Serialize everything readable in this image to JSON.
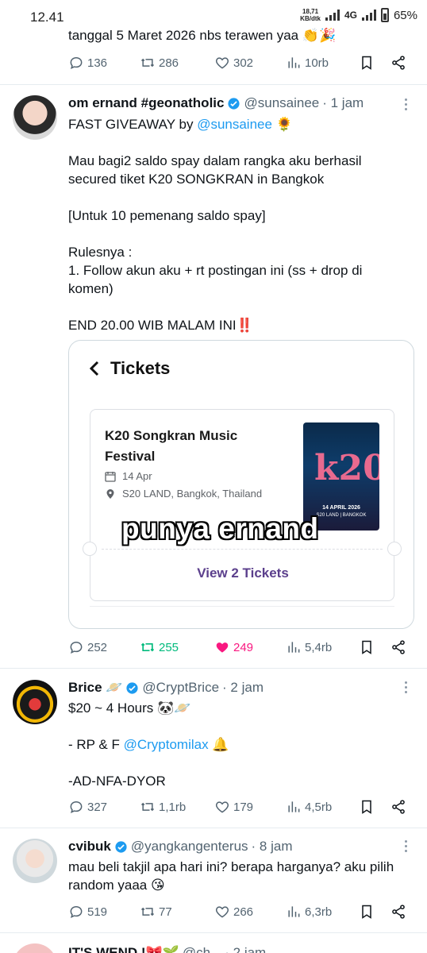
{
  "status": {
    "time": "12.41",
    "net_speed_value": "18,71",
    "net_speed_unit": "KB/dtk",
    "network": "4G",
    "battery": "65%"
  },
  "prev_tweet": {
    "text_tail": "tanggal 5 Maret 2026 nbs terawen yaa 👏🎉",
    "replies": "136",
    "retweets": "286",
    "likes": "302",
    "views": "10rb"
  },
  "tweets": [
    {
      "name": "om ernand #geonatholic",
      "handle": "@sunsainee",
      "time": "· 1 jam",
      "line1_prefix": "FAST GIVEAWAY by ",
      "line1_mention": "@sunsainee",
      "line1_suffix": " 🌻",
      "para1": "Mau bagi2 saldo spay dalam rangka aku berhasil secured tiket K20 SONGKRAN in Bangkok",
      "para2": "[Untuk 10 pemenang saldo spay]",
      "para3": "Rulesnya :\n1. Follow akun aku + rt postingan ini (ss + drop di komen)",
      "para4": "END 20.00 WIB MALAM INI‼️",
      "card": {
        "header": "Tickets",
        "event_name": "K20 Songkran Music Festival",
        "date": "14 Apr",
        "location": "S20 LAND, Bangkok, Thailand",
        "overlay": "punya ernand",
        "button": "View 2 Tickets",
        "poster_date": "14 APRIL 2026",
        "poster_venue": "S20 LAND | BANGKOK"
      },
      "replies": "252",
      "retweets": "255",
      "likes": "249",
      "views": "5,4rb"
    },
    {
      "name": "Brice 🪐",
      "handle": "@CryptBrice",
      "time": "· 2 jam",
      "line1": "$20 ~ 4 Hours 🐼🪐",
      "line2_prefix": "- RP & F ",
      "line2_mention": "@Cryptomilax",
      "line2_suffix": " 🔔",
      "line3": "-AD-NFA-DYOR",
      "replies": "327",
      "retweets": "1,1rb",
      "likes": "179",
      "views": "4,5rb"
    },
    {
      "name": "cvibuk",
      "handle": "@yangkangenterus",
      "time": "· 8 jam",
      "text": "mau beli takjil apa hari ini? berapa harganya? aku pilih random yaaa 😘",
      "replies": "519",
      "retweets": "77",
      "likes": "266",
      "views": "6,3rb"
    }
  ],
  "next_tweet": {
    "name_partial": "IT'S WEND !🎀🌱",
    "handle_partial": "@ch...",
    "time_partial": "· 2 jam"
  },
  "colors": {
    "link": "#1d9bf0",
    "like": "#f91880",
    "retweet": "#00ba7c",
    "muted": "#536471",
    "ticket_button": "#5b3f8c"
  }
}
